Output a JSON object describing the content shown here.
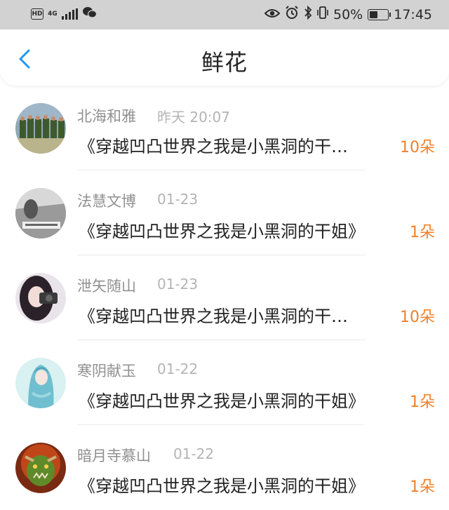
{
  "status_bar": {
    "hd": "HD",
    "network": "4G",
    "battery_percent": "50%",
    "battery_level": 0.5,
    "time": "17:45"
  },
  "header": {
    "title": "鲜花",
    "back_icon": "chevron-left-icon",
    "accent_color": "#2196f3"
  },
  "items": [
    {
      "name": "北海和雅",
      "time": "昨天 20:07",
      "book": "《穿越凹凸世界之我是小黑洞的干…",
      "count": "10朵",
      "avatar": "soldiers"
    },
    {
      "name": "法慧文博",
      "time": "01-23",
      "book": "《穿越凹凸世界之我是小黑洞的干姐》",
      "count": "1朵",
      "avatar": "gray-photo"
    },
    {
      "name": "泄矢随山",
      "time": "01-23",
      "book": "《穿越凹凸世界之我是小黑洞的干…",
      "count": "10朵",
      "avatar": "camera-girl"
    },
    {
      "name": "寒阴献玉",
      "time": "01-22",
      "book": "《穿越凹凸世界之我是小黑洞的干姐》",
      "count": "1朵",
      "avatar": "anime-blue"
    },
    {
      "name": "暗月寺慕山",
      "time": "01-22",
      "book": "《穿越凹凸世界之我是小黑洞的干姐》",
      "count": "1朵",
      "avatar": "orc"
    }
  ]
}
